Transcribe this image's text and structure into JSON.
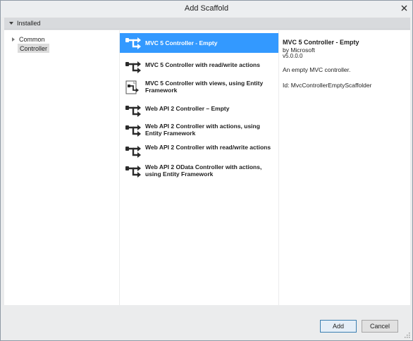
{
  "window": {
    "title": "Add Scaffold",
    "close_glyph": "✕"
  },
  "tree": {
    "header": "Installed",
    "items": [
      {
        "label": "Common",
        "expandable": true,
        "selected": false
      },
      {
        "label": "Controller",
        "expandable": false,
        "selected": true
      }
    ]
  },
  "scaffolds": [
    {
      "label": "MVC 5 Controller - Empty",
      "icon": "controller-icon",
      "selected": true
    },
    {
      "label": "MVC 5 Controller with read/write actions",
      "icon": "controller-icon",
      "selected": false
    },
    {
      "label": "MVC 5 Controller with views, using Entity Framework",
      "icon": "controller-views-icon",
      "selected": false
    },
    {
      "label": "Web API 2 Controller – Empty",
      "icon": "controller-icon",
      "selected": false
    },
    {
      "label": "Web API 2 Controller with actions, using Entity Framework",
      "icon": "controller-icon",
      "selected": false
    },
    {
      "label": "Web API 2 Controller with read/write actions",
      "icon": "controller-icon",
      "selected": false
    },
    {
      "label": "Web API 2 OData Controller with actions, using Entity Framework",
      "icon": "controller-icon",
      "selected": false
    }
  ],
  "details": {
    "title": "MVC 5 Controller - Empty",
    "author": "by Microsoft",
    "version": "v5.0.0.0",
    "description": "An empty MVC controller.",
    "id": "Id: MvcControllerEmptyScaffolder"
  },
  "buttons": {
    "add": "Add",
    "cancel": "Cancel"
  },
  "colors": {
    "selection": "#3399ff",
    "window_bg": "#ebeced",
    "header_bg": "#d8dadd"
  }
}
